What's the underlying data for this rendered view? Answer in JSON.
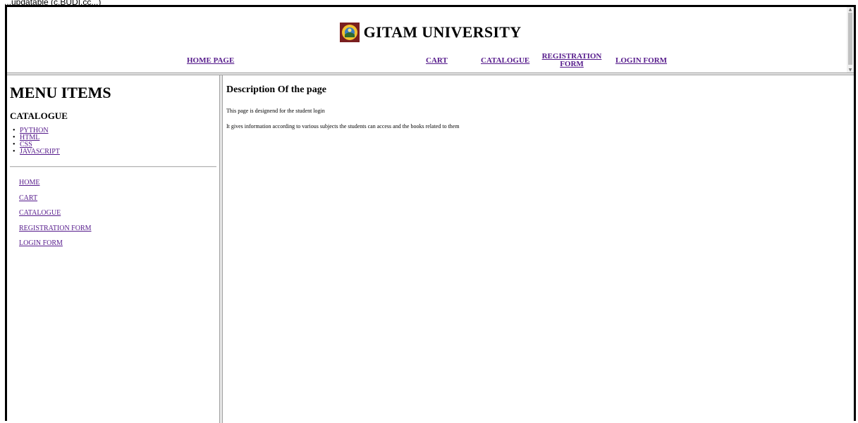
{
  "browser": {
    "caption": "...updatable (c.BUDI.cc...)"
  },
  "header": {
    "title": "GITAM UNIVERSITY",
    "logo_icon": "gitam-logo",
    "logo_color": "#7a1f1f",
    "nav": [
      {
        "label": "HOME PAGE"
      },
      {
        "label": "CART"
      },
      {
        "label": "CATALOGUE"
      },
      {
        "label": "REGISTRATION FORM"
      },
      {
        "label": "LOGIN FORM"
      }
    ]
  },
  "sidebar": {
    "title": "MENU ITEMS",
    "catalogue_heading": "CATALOGUE",
    "catalogue_items": [
      {
        "label": "PYTHON"
      },
      {
        "label": "HTML"
      },
      {
        "label": "CSS"
      },
      {
        "label": "JAVASCRIPT"
      }
    ],
    "links": [
      {
        "label": "HOME"
      },
      {
        "label": "CART"
      },
      {
        "label": "CATALOGUE"
      },
      {
        "label": "REGISTRATION FORM"
      },
      {
        "label": "LOGIN FORM"
      }
    ]
  },
  "main": {
    "heading": "Description Of the page",
    "paragraphs": [
      "This page is designend for the student login",
      "It gives information according to various subjects the students can access and the books related to them"
    ]
  },
  "colors": {
    "link": "#551a8b",
    "frame_border": "#000000"
  }
}
